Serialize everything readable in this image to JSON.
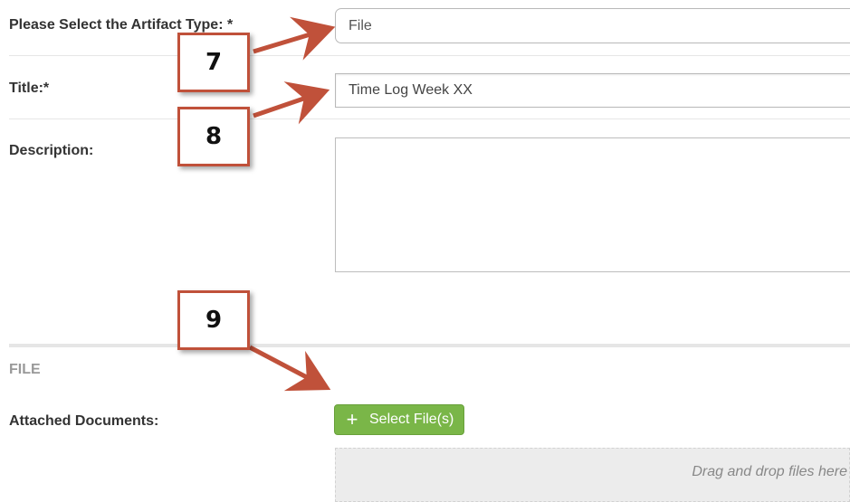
{
  "form": {
    "artifact_type_label": "Please Select the Artifact Type: *",
    "artifact_type_value": "File",
    "title_label": "Title:*",
    "title_value": "Time Log Week XX",
    "description_label": "Description:",
    "description_value": ""
  },
  "file_section": {
    "heading": "FILE",
    "attached_documents_label": "Attached Documents:",
    "select_files_label": "Select File(s)",
    "drop_zone_text": "Drag and drop files here"
  },
  "callouts": {
    "seven": "7",
    "eight": "8",
    "nine": "9"
  },
  "colors": {
    "callout_border": "#c0513a",
    "arrow": "#c0513a",
    "button_green": "#7ab648"
  },
  "icons": {
    "plus": "plus-icon"
  }
}
